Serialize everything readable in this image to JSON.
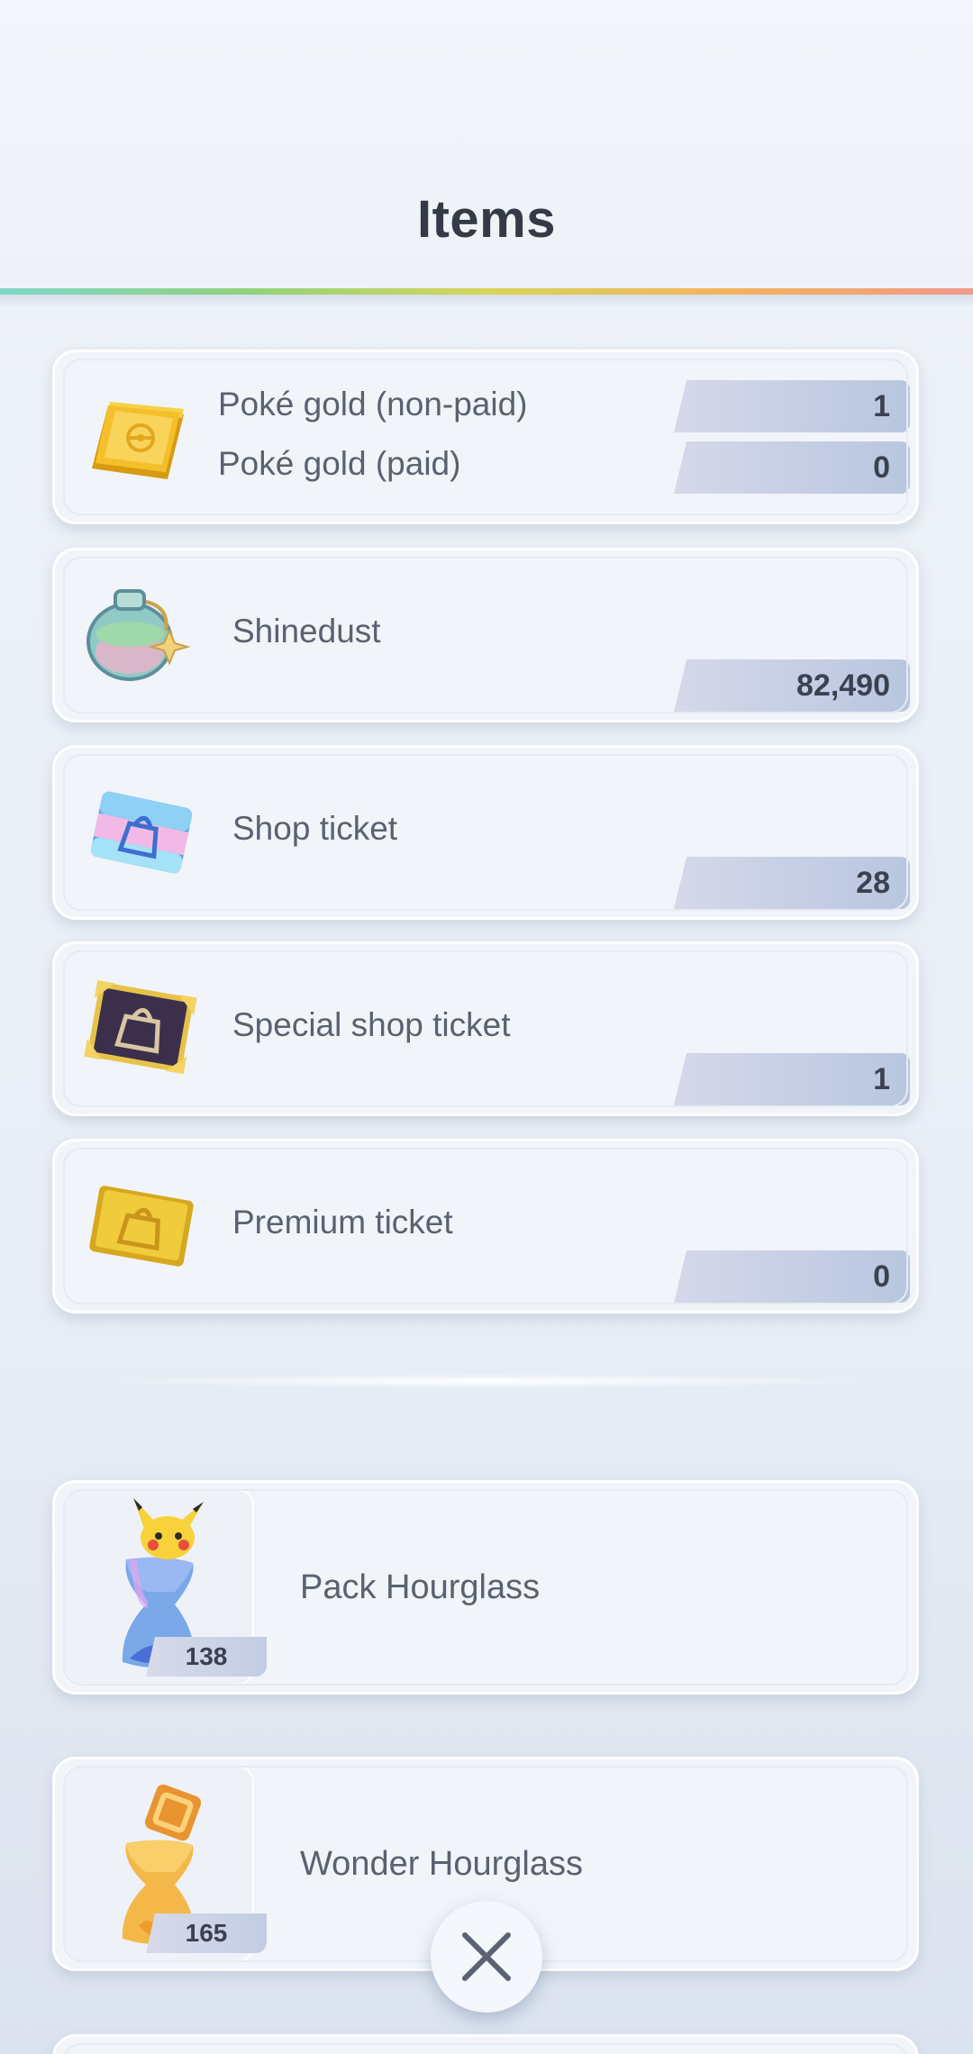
{
  "header": {
    "title": "Items"
  },
  "currency": {
    "poke_gold": {
      "icon": "gold-bar-icon",
      "rows": [
        {
          "label": "Poké gold (non-paid)",
          "value": "1"
        },
        {
          "label": "Poké gold (paid)",
          "value": "0"
        }
      ]
    },
    "items": [
      {
        "icon": "shinedust-bottle-icon",
        "label": "Shinedust",
        "value": "82,490"
      },
      {
        "icon": "shop-ticket-icon",
        "label": "Shop ticket",
        "value": "28"
      },
      {
        "icon": "special-shop-ticket-icon",
        "label": "Special shop ticket",
        "value": "1"
      },
      {
        "icon": "premium-ticket-icon",
        "label": "Premium ticket",
        "value": "0"
      }
    ]
  },
  "hourglasses": [
    {
      "icon": "pack-hourglass-icon",
      "label": "Pack Hourglass",
      "count": "138"
    },
    {
      "icon": "wonder-hourglass-icon",
      "label": "Wonder Hourglass",
      "count": "165"
    }
  ],
  "close": {
    "icon": "close-icon"
  }
}
